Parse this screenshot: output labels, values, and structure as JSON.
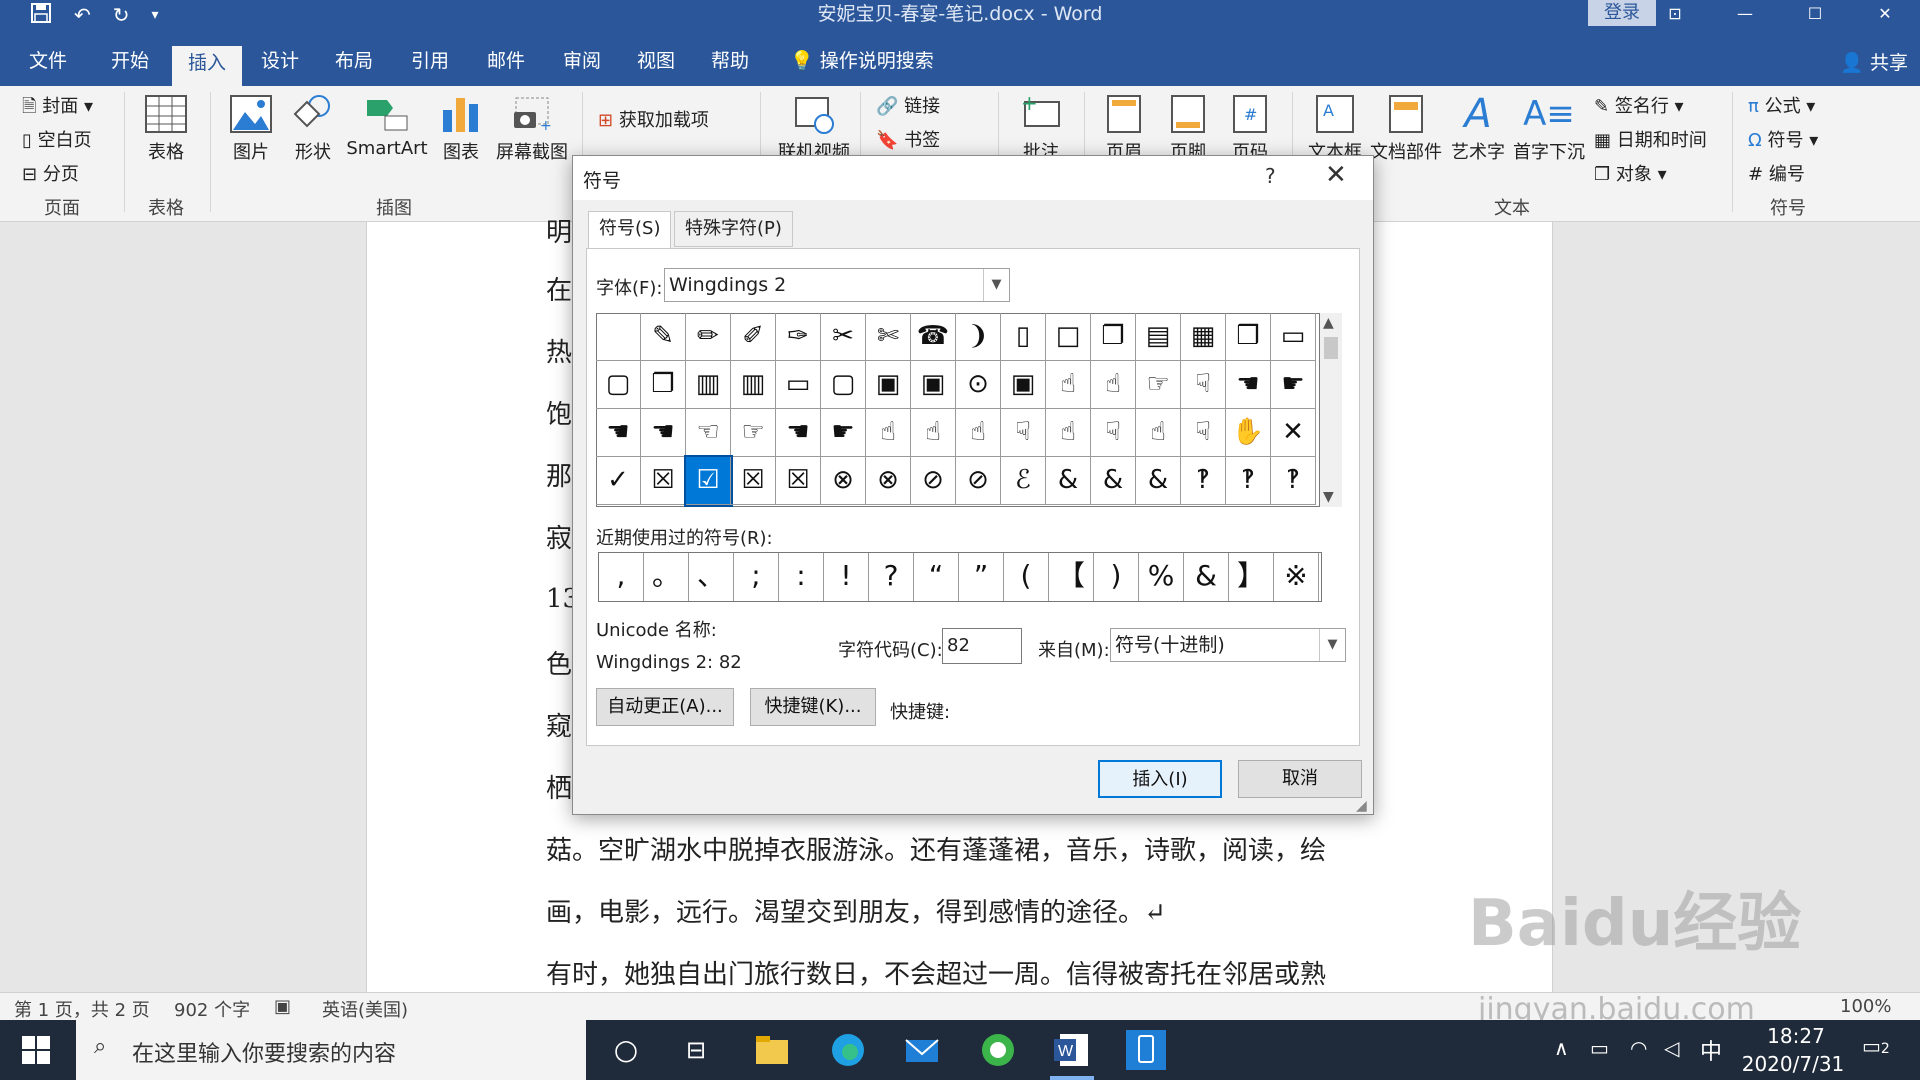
{
  "titlebar": {
    "title": "安妮宝贝-春宴-笔记.docx  -  Word",
    "login": "登录",
    "qat_icons": [
      "save-icon",
      "undo-icon",
      "redo-icon",
      "customize-icon"
    ]
  },
  "tabs": [
    "文件",
    "开始",
    "插入",
    "设计",
    "布局",
    "引用",
    "邮件",
    "审阅",
    "视图",
    "帮助",
    "操作说明搜索"
  ],
  "active_tab": "插入",
  "share": "共享",
  "ribbon": {
    "pages": {
      "cover": "封面",
      "blank": "空白页",
      "break": "分页",
      "label": "页面"
    },
    "table": {
      "btn": "表格",
      "label": "表格"
    },
    "illustrations": {
      "picture": "图片",
      "shapes": "形状",
      "smartart": "SmartArt",
      "chart": "图表",
      "screenshot": "屏幕截图",
      "label": "插图"
    },
    "addins": {
      "get": "获取加载项"
    },
    "media": {
      "video": "联机视频"
    },
    "links": {
      "link": "链接",
      "bookmark": "书签"
    },
    "comments": {
      "comment": "批注"
    },
    "hf": {
      "header": "页眉",
      "footer": "页脚",
      "pagenum": "页码"
    },
    "text": {
      "textbox": "文本框",
      "parts": "文档部件",
      "wordart": "艺术字",
      "dropcap": "首字下沉",
      "sigline": "签名行",
      "datetime": "日期和时间",
      "object": "对象",
      "label": "文本"
    },
    "symbols": {
      "equation": "公式",
      "symbol": "符号",
      "number": "编号",
      "label": "符号"
    }
  },
  "document": {
    "left_chars": [
      "明",
      "在",
      "热",
      "饱",
      "那",
      "寂",
      "13",
      "色",
      "窥",
      "栖"
    ],
    "line1": "菇。空旷湖水中脱掉衣服游泳。还有蓬蓬裙，音乐，诗歌，阅读，绘",
    "line2": "画，电影，远行。渴望交到朋友，得到感情的途径。↵",
    "line3": "有时，她独自出门旅行数日，不会超过一周。信得被寄托在邻居或熟"
  },
  "dialog": {
    "title": "符号",
    "help": "?",
    "close": "✕",
    "tab_symbols": "符号(S)",
    "tab_special": "特殊字符(P)",
    "font_label": "字体(F):",
    "font_value": "Wingdings 2",
    "symbols": [
      " ",
      "✎",
      "✏",
      "✐",
      "✑",
      "✂",
      "✄",
      "☎",
      "❩",
      "▯",
      "□",
      "❐",
      "▤",
      "▦",
      "❒",
      "▭",
      "▢",
      "❐",
      "▥",
      "▥",
      "▭",
      "▢",
      "▣",
      "▣",
      "⊙",
      "▣",
      "☝",
      "☝",
      "☞",
      "☟",
      "☚",
      "☛",
      "☚",
      "☚",
      "☜",
      "☞",
      "☚",
      "☛",
      "☝",
      "☝",
      "☝",
      "☟",
      "☝",
      "☟",
      "☝",
      "☟",
      "✋",
      "✕",
      "✓",
      "☒",
      "☑",
      "☒",
      "☒",
      "⊗",
      "⊗",
      "⊘",
      "⊘",
      "ℰ",
      "&",
      "&",
      "&",
      "‽",
      "‽",
      "‽"
    ],
    "selected_index": 50,
    "recent_label": "近期使用过的符号(R):",
    "recent": [
      ",",
      "。",
      "、",
      ";",
      ":",
      "!",
      "?",
      "“",
      "”",
      "(",
      "【",
      ")",
      "%",
      "&",
      "】",
      "※"
    ],
    "unicode_label": "Unicode 名称:",
    "unicode_value": "Wingdings 2: 82",
    "code_label": "字符代码(C):",
    "code_value": "82",
    "from_label": "来自(M):",
    "from_value": "符号(十进制)",
    "autocorrect": "自动更正(A)...",
    "shortcut_btn": "快捷键(K)...",
    "shortcut_label": "快捷键:",
    "insert": "插入(I)",
    "cancel": "取消"
  },
  "statusbar": {
    "page": "第 1 页，共 2 页",
    "words": "902 个字",
    "lang": "英语(美国)",
    "zoom": "100%"
  },
  "taskbar": {
    "search_placeholder": "在这里输入你要搜索的内容",
    "ime": "中",
    "time": "18:27",
    "date": "2020/7/31",
    "notif_count": "2"
  },
  "watermark": {
    "brand": "Baidu经验",
    "url": "jingyan.baidu.com"
  }
}
